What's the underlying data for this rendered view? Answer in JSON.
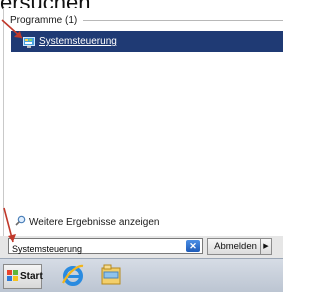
{
  "page_top": {
    "heading": "ersuchen"
  },
  "start_menu": {
    "section_header": "Programme (1)",
    "results": [
      {
        "label": "Systemsteuerung",
        "icon": "control-panel-icon"
      }
    ],
    "more_results": "Weitere Ergebnisse anzeigen",
    "search_value": "Systemsteuerung",
    "logoff_label": "Abmelden",
    "arrow_symbol": "▶"
  },
  "taskbar": {
    "start_label": "Start",
    "apps": [
      {
        "name": "internet-explorer-icon"
      },
      {
        "name": "file-explorer-icon"
      }
    ]
  },
  "colors": {
    "highlight": "#1f3a74",
    "annotation_arrow": "#c0392b"
  }
}
